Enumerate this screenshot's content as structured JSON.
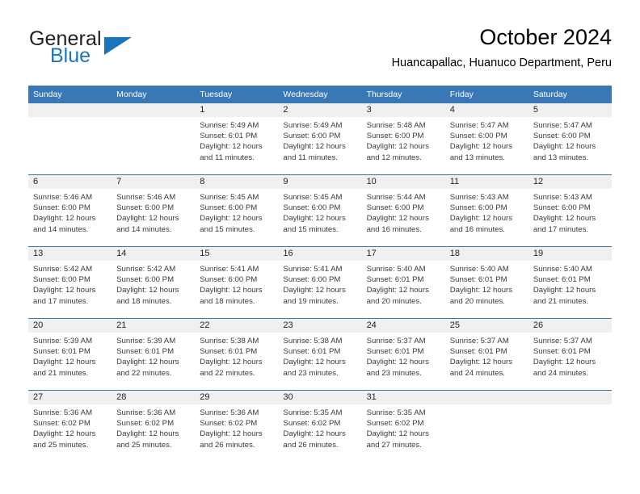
{
  "brand": {
    "name_top": "General",
    "name_bottom": "Blue",
    "triangle_icon": "blue-triangle-icon",
    "color_text": "#231f20",
    "color_accent": "#1b75bb"
  },
  "header": {
    "title": "October 2024",
    "subtitle": "Huancapallac, Huanuco Department, Peru"
  },
  "calendar": {
    "header_bg": "#3a77b5",
    "daynum_bg": "#f0f0f0",
    "separator_color": "#3a77b5",
    "weekday_headers": [
      "Sunday",
      "Monday",
      "Tuesday",
      "Wednesday",
      "Thursday",
      "Friday",
      "Saturday"
    ],
    "weeks": [
      [
        {
          "day": "",
          "sunrise": "",
          "sunset": "",
          "daylight_1": "",
          "daylight_2": ""
        },
        {
          "day": "",
          "sunrise": "",
          "sunset": "",
          "daylight_1": "",
          "daylight_2": ""
        },
        {
          "day": "1",
          "sunrise": "Sunrise: 5:49 AM",
          "sunset": "Sunset: 6:01 PM",
          "daylight_1": "Daylight: 12 hours",
          "daylight_2": "and 11 minutes."
        },
        {
          "day": "2",
          "sunrise": "Sunrise: 5:49 AM",
          "sunset": "Sunset: 6:00 PM",
          "daylight_1": "Daylight: 12 hours",
          "daylight_2": "and 11 minutes."
        },
        {
          "day": "3",
          "sunrise": "Sunrise: 5:48 AM",
          "sunset": "Sunset: 6:00 PM",
          "daylight_1": "Daylight: 12 hours",
          "daylight_2": "and 12 minutes."
        },
        {
          "day": "4",
          "sunrise": "Sunrise: 5:47 AM",
          "sunset": "Sunset: 6:00 PM",
          "daylight_1": "Daylight: 12 hours",
          "daylight_2": "and 13 minutes."
        },
        {
          "day": "5",
          "sunrise": "Sunrise: 5:47 AM",
          "sunset": "Sunset: 6:00 PM",
          "daylight_1": "Daylight: 12 hours",
          "daylight_2": "and 13 minutes."
        }
      ],
      [
        {
          "day": "6",
          "sunrise": "Sunrise: 5:46 AM",
          "sunset": "Sunset: 6:00 PM",
          "daylight_1": "Daylight: 12 hours",
          "daylight_2": "and 14 minutes."
        },
        {
          "day": "7",
          "sunrise": "Sunrise: 5:46 AM",
          "sunset": "Sunset: 6:00 PM",
          "daylight_1": "Daylight: 12 hours",
          "daylight_2": "and 14 minutes."
        },
        {
          "day": "8",
          "sunrise": "Sunrise: 5:45 AM",
          "sunset": "Sunset: 6:00 PM",
          "daylight_1": "Daylight: 12 hours",
          "daylight_2": "and 15 minutes."
        },
        {
          "day": "9",
          "sunrise": "Sunrise: 5:45 AM",
          "sunset": "Sunset: 6:00 PM",
          "daylight_1": "Daylight: 12 hours",
          "daylight_2": "and 15 minutes."
        },
        {
          "day": "10",
          "sunrise": "Sunrise: 5:44 AM",
          "sunset": "Sunset: 6:00 PM",
          "daylight_1": "Daylight: 12 hours",
          "daylight_2": "and 16 minutes."
        },
        {
          "day": "11",
          "sunrise": "Sunrise: 5:43 AM",
          "sunset": "Sunset: 6:00 PM",
          "daylight_1": "Daylight: 12 hours",
          "daylight_2": "and 16 minutes."
        },
        {
          "day": "12",
          "sunrise": "Sunrise: 5:43 AM",
          "sunset": "Sunset: 6:00 PM",
          "daylight_1": "Daylight: 12 hours",
          "daylight_2": "and 17 minutes."
        }
      ],
      [
        {
          "day": "13",
          "sunrise": "Sunrise: 5:42 AM",
          "sunset": "Sunset: 6:00 PM",
          "daylight_1": "Daylight: 12 hours",
          "daylight_2": "and 17 minutes."
        },
        {
          "day": "14",
          "sunrise": "Sunrise: 5:42 AM",
          "sunset": "Sunset: 6:00 PM",
          "daylight_1": "Daylight: 12 hours",
          "daylight_2": "and 18 minutes."
        },
        {
          "day": "15",
          "sunrise": "Sunrise: 5:41 AM",
          "sunset": "Sunset: 6:00 PM",
          "daylight_1": "Daylight: 12 hours",
          "daylight_2": "and 18 minutes."
        },
        {
          "day": "16",
          "sunrise": "Sunrise: 5:41 AM",
          "sunset": "Sunset: 6:00 PM",
          "daylight_1": "Daylight: 12 hours",
          "daylight_2": "and 19 minutes."
        },
        {
          "day": "17",
          "sunrise": "Sunrise: 5:40 AM",
          "sunset": "Sunset: 6:01 PM",
          "daylight_1": "Daylight: 12 hours",
          "daylight_2": "and 20 minutes."
        },
        {
          "day": "18",
          "sunrise": "Sunrise: 5:40 AM",
          "sunset": "Sunset: 6:01 PM",
          "daylight_1": "Daylight: 12 hours",
          "daylight_2": "and 20 minutes."
        },
        {
          "day": "19",
          "sunrise": "Sunrise: 5:40 AM",
          "sunset": "Sunset: 6:01 PM",
          "daylight_1": "Daylight: 12 hours",
          "daylight_2": "and 21 minutes."
        }
      ],
      [
        {
          "day": "20",
          "sunrise": "Sunrise: 5:39 AM",
          "sunset": "Sunset: 6:01 PM",
          "daylight_1": "Daylight: 12 hours",
          "daylight_2": "and 21 minutes."
        },
        {
          "day": "21",
          "sunrise": "Sunrise: 5:39 AM",
          "sunset": "Sunset: 6:01 PM",
          "daylight_1": "Daylight: 12 hours",
          "daylight_2": "and 22 minutes."
        },
        {
          "day": "22",
          "sunrise": "Sunrise: 5:38 AM",
          "sunset": "Sunset: 6:01 PM",
          "daylight_1": "Daylight: 12 hours",
          "daylight_2": "and 22 minutes."
        },
        {
          "day": "23",
          "sunrise": "Sunrise: 5:38 AM",
          "sunset": "Sunset: 6:01 PM",
          "daylight_1": "Daylight: 12 hours",
          "daylight_2": "and 23 minutes."
        },
        {
          "day": "24",
          "sunrise": "Sunrise: 5:37 AM",
          "sunset": "Sunset: 6:01 PM",
          "daylight_1": "Daylight: 12 hours",
          "daylight_2": "and 23 minutes."
        },
        {
          "day": "25",
          "sunrise": "Sunrise: 5:37 AM",
          "sunset": "Sunset: 6:01 PM",
          "daylight_1": "Daylight: 12 hours",
          "daylight_2": "and 24 minutes."
        },
        {
          "day": "26",
          "sunrise": "Sunrise: 5:37 AM",
          "sunset": "Sunset: 6:01 PM",
          "daylight_1": "Daylight: 12 hours",
          "daylight_2": "and 24 minutes."
        }
      ],
      [
        {
          "day": "27",
          "sunrise": "Sunrise: 5:36 AM",
          "sunset": "Sunset: 6:02 PM",
          "daylight_1": "Daylight: 12 hours",
          "daylight_2": "and 25 minutes."
        },
        {
          "day": "28",
          "sunrise": "Sunrise: 5:36 AM",
          "sunset": "Sunset: 6:02 PM",
          "daylight_1": "Daylight: 12 hours",
          "daylight_2": "and 25 minutes."
        },
        {
          "day": "29",
          "sunrise": "Sunrise: 5:36 AM",
          "sunset": "Sunset: 6:02 PM",
          "daylight_1": "Daylight: 12 hours",
          "daylight_2": "and 26 minutes."
        },
        {
          "day": "30",
          "sunrise": "Sunrise: 5:35 AM",
          "sunset": "Sunset: 6:02 PM",
          "daylight_1": "Daylight: 12 hours",
          "daylight_2": "and 26 minutes."
        },
        {
          "day": "31",
          "sunrise": "Sunrise: 5:35 AM",
          "sunset": "Sunset: 6:02 PM",
          "daylight_1": "Daylight: 12 hours",
          "daylight_2": "and 27 minutes."
        },
        {
          "day": "",
          "sunrise": "",
          "sunset": "",
          "daylight_1": "",
          "daylight_2": ""
        },
        {
          "day": "",
          "sunrise": "",
          "sunset": "",
          "daylight_1": "",
          "daylight_2": ""
        }
      ]
    ]
  }
}
